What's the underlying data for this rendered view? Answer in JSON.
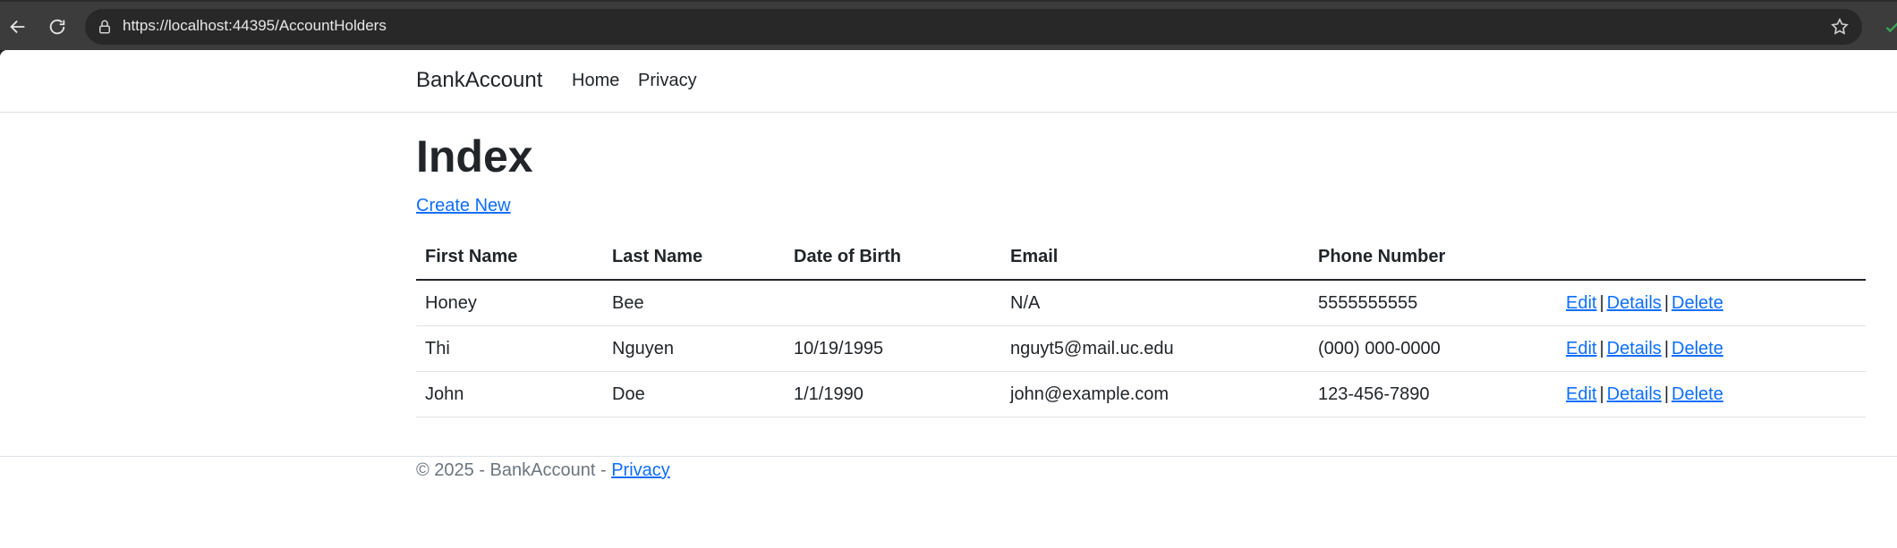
{
  "browser": {
    "url": "https://localhost:44395/AccountHolders"
  },
  "navbar": {
    "brand": "BankAccount",
    "links": [
      {
        "label": "Home"
      },
      {
        "label": "Privacy"
      }
    ]
  },
  "main": {
    "title": "Index",
    "create_link": "Create New",
    "table": {
      "headers": [
        "First Name",
        "Last Name",
        "Date of Birth",
        "Email",
        "Phone Number",
        ""
      ],
      "rows": [
        {
          "first": "Honey",
          "last": "Bee",
          "dob": "",
          "email": "N/A",
          "phone": "5555555555"
        },
        {
          "first": "Thi",
          "last": "Nguyen",
          "dob": "10/19/1995",
          "email": "nguyt5@mail.uc.edu",
          "phone": "(000) 000-0000"
        },
        {
          "first": "John",
          "last": "Doe",
          "dob": "1/1/1990",
          "email": "john@example.com",
          "phone": "123-456-7890"
        }
      ],
      "actions": {
        "edit": "Edit",
        "details": "Details",
        "delete": "Delete",
        "separator": "|"
      }
    }
  },
  "footer": {
    "text": "© 2025 - BankAccount - ",
    "privacy_link": "Privacy"
  },
  "colors": {
    "link": "#0d6efd",
    "text": "#212529",
    "muted": "#6c757d",
    "chrome": "#3c3c3c"
  }
}
